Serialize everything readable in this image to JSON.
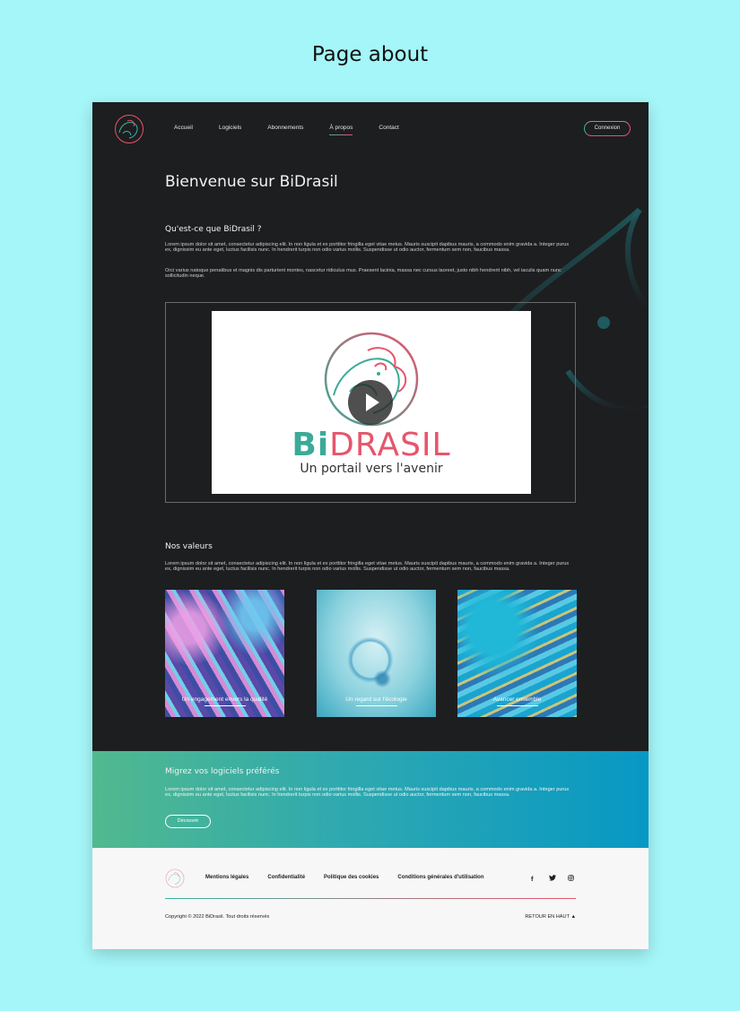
{
  "caption": "Page about",
  "nav": {
    "items": [
      {
        "label": "Accueil",
        "active": false
      },
      {
        "label": "Logiciels",
        "active": false
      },
      {
        "label": "Abonnements",
        "active": false
      },
      {
        "label": "À propos",
        "active": true
      },
      {
        "label": "Contact",
        "active": false
      }
    ],
    "login_label": "Connexion"
  },
  "main": {
    "title": "Bienvenue sur BiDrasil",
    "about_heading": "Qu'est-ce que BiDrasil ?",
    "about_p1": "Lorem ipsum dolor sit amet, consectetur adipiscing elit. In non ligula et ex porttitor fringilla eget vitae metus. Mauris suscipit dapibus mauris, a commodo enim gravida a. Integer purus ex, dignissim eu ante eget, luctus facilisis nunc. In hendrerit turpis non odio varius mollis. Suspendisse ut odio auctor, fermentum sem non, faucibus massa.",
    "about_p2": "Orci varius natoque penatibus et magnis dis parturient montes, nascetur ridiculus mus. Praesent lacinia, massa nec cursus laoreet, justo nibh hendrerit nibh, vel iaculis quam nunc sollicitudin neque.",
    "video": {
      "brand_bi": "Bi",
      "brand_rest": "DRASIL",
      "tagline": "Un portail vers l'avenir"
    },
    "values_heading": "Nos valeurs",
    "values_p": "Lorem ipsum dolor sit amet, consectetur adipiscing elit. In non ligula et ex porttitor fringilla eget vitae metus. Mauris suscipit dapibus mauris, a commodo enim gravida a. Integer purus ex, dignissim eu ante eget, luctus facilisis nunc. In hendrerit turpis non odio varius mollis. Suspendisse ut odio auctor, fermentum sem non, faucibus massa.",
    "cards": [
      {
        "label": "Un engagement envers la qualité"
      },
      {
        "label": "Un regard sur l'écologie"
      },
      {
        "label": "Avancer ensemble"
      }
    ]
  },
  "migrate": {
    "heading": "Migrez vos logiciels préférés",
    "text": "Lorem ipsum dolor sit amet, consectetur adipiscing elit. In non ligula et ex porttitor fringilla eget vitae metus. Mauris suscipit dapibus mauris, a commodo enim gravida a. Integer purus ex, dignissim eu ante eget, luctus facilisis nunc. In hendrerit turpis non odio varius mollis. Suspendisse ut odio auctor, fermentum sem non, faucibus massa.",
    "button": "Découvrir"
  },
  "footer": {
    "links": [
      "Mentions légales",
      "Confidentialité",
      "Politique des cookies",
      "Conditions générales d'utilisation"
    ],
    "social": [
      "facebook-icon",
      "twitter-icon",
      "instagram-icon"
    ],
    "copyright": "Copyright © 2022 BiDrasil. Tout droits réservés",
    "back_to_top": "RETOUR EN HAUT ▲"
  },
  "colors": {
    "accent_green": "#3bb3a0",
    "accent_red": "#e8536b",
    "dark_bg": "#1d1e20"
  }
}
